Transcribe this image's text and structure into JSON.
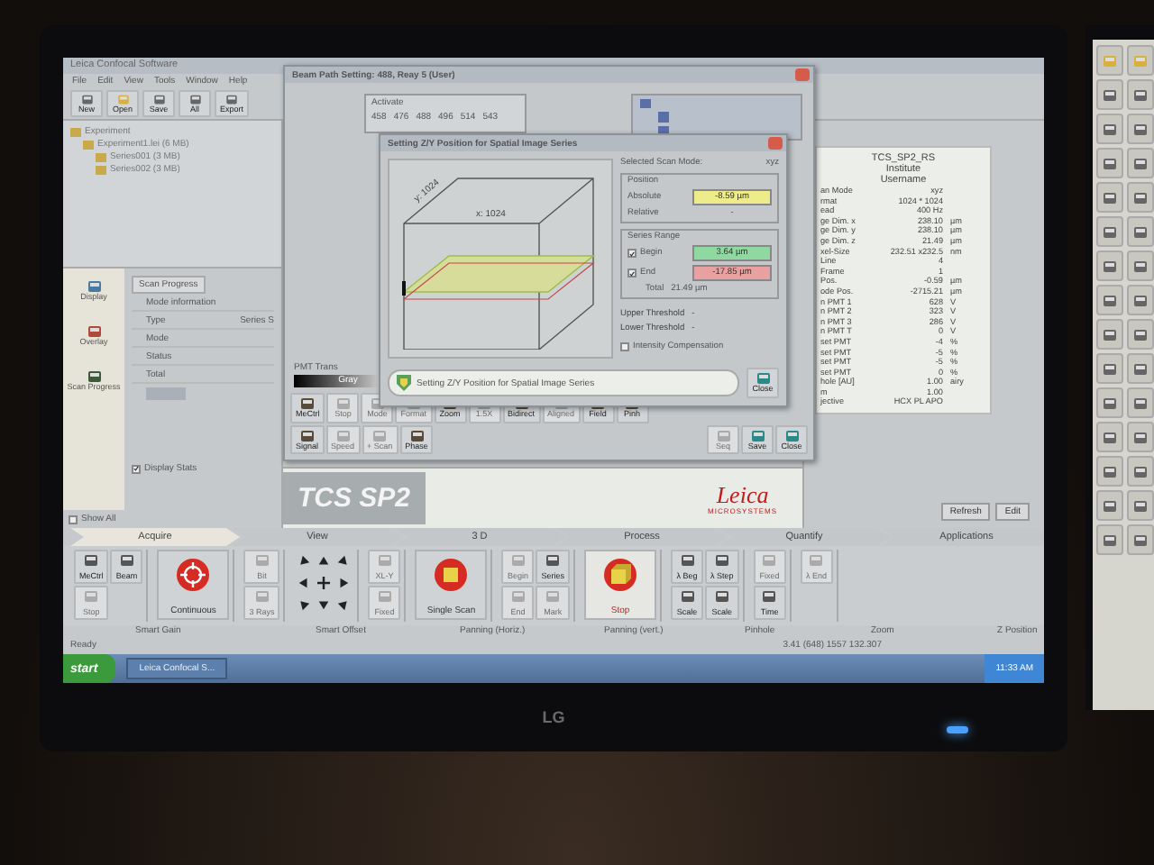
{
  "app": {
    "title": "Leica Confocal Software",
    "menu": [
      "File",
      "Edit",
      "View",
      "Tools",
      "Window",
      "Help"
    ],
    "toolbar": [
      {
        "label": "New"
      },
      {
        "label": "Open"
      },
      {
        "label": "Save"
      },
      {
        "label": "All"
      },
      {
        "label": "Export"
      }
    ],
    "tree": [
      {
        "label": "Experiment",
        "children": [
          {
            "label": "Experiment1.lei (6 MB)",
            "children": [
              {
                "label": "Series001 (3 MB)"
              },
              {
                "label": "Series002 (3 MB)"
              }
            ]
          }
        ]
      }
    ],
    "side_tools": [
      {
        "label": "Display"
      },
      {
        "label": "Overlay"
      },
      {
        "label": "Scan Progress"
      }
    ],
    "scan_progress": {
      "tab": "Scan Progress",
      "rows": [
        {
          "label": "Mode information"
        },
        {
          "label": "Type",
          "value": "Series S"
        },
        {
          "label": "Mode"
        },
        {
          "label": "Status"
        },
        {
          "label": "Total"
        }
      ],
      "display_stats": {
        "label": "Display Stats",
        "checked": true
      }
    },
    "show_all": {
      "label": "Show All",
      "checked": false
    },
    "logo": {
      "product": "TCS SP2",
      "brand": "Leica",
      "tagline": "MICROSYSTEMS"
    },
    "info_panel": {
      "header": [
        "TCS_SP2_RS",
        "Institute",
        "Username"
      ],
      "rows": [
        {
          "label": "an Mode",
          "value": "xyz"
        },
        {
          "label": "rmat",
          "value": "1024 * 1024"
        },
        {
          "label": "ead",
          "value": "400 Hz"
        },
        {
          "label": "ge Dim. x",
          "value": "238.10",
          "unit": "µm"
        },
        {
          "label": "ge Dim. y",
          "value": "238.10",
          "unit": "µm"
        },
        {
          "label": "ge Dim. z",
          "value": "21.49",
          "unit": "µm"
        },
        {
          "label": "xel-Size",
          "value": "232.51 x232.5",
          "unit": "nm"
        },
        {
          "label": "Line",
          "value": "4"
        },
        {
          "label": "Frame",
          "value": "1"
        },
        {
          "label": "Pos.",
          "value": "-0.59",
          "unit": "µm"
        },
        {
          "label": "ode Pos.",
          "value": "-2715.21",
          "unit": "µm"
        },
        {
          "label": "n PMT 1",
          "value": "628",
          "unit": "V"
        },
        {
          "label": "n PMT 2",
          "value": "323",
          "unit": "V"
        },
        {
          "label": "n PMT 3",
          "value": "286",
          "unit": "V"
        },
        {
          "label": "n PMT T",
          "value": "0",
          "unit": "V"
        },
        {
          "label": "set PMT",
          "value": "-4",
          "unit": "%"
        },
        {
          "label": "set PMT",
          "value": "-5",
          "unit": "%"
        },
        {
          "label": "set PMT",
          "value": "-5",
          "unit": "%"
        },
        {
          "label": "set PMT",
          "value": "0",
          "unit": "%"
        },
        {
          "label": "hole [AU]",
          "value": "1.00",
          "unit": "airy"
        },
        {
          "label": "m",
          "value": "1.00"
        },
        {
          "label": "jective",
          "value": "HCX PL APO"
        }
      ],
      "buttons": [
        "Refresh",
        "Edit"
      ]
    },
    "beam_window": {
      "title": "Beam Path Setting: 488, Reay 5 (User)",
      "activate": {
        "title": "Activate",
        "items": [
          "458",
          "476",
          "488",
          "496",
          "514",
          "543"
        ]
      },
      "pmt": {
        "label": "PMT Trans",
        "value": "Gray"
      },
      "tool_rows": [
        [
          {
            "label": "MeCtrl",
            "disabled": false
          },
          {
            "label": "Stop",
            "disabled": true
          },
          {
            "label": "Mode",
            "disabled": true
          },
          {
            "label": "Format",
            "disabled": true
          },
          {
            "label": "Zoom",
            "disabled": false
          },
          {
            "label": "1.5X",
            "disabled": true
          },
          {
            "label": "Bidirect",
            "disabled": false
          },
          {
            "label": "Aligned",
            "disabled": true
          },
          {
            "label": "Field",
            "disabled": false
          },
          {
            "label": "Pinh",
            "disabled": false
          }
        ],
        [
          {
            "label": "Signal",
            "disabled": false
          },
          {
            "label": "Speed",
            "disabled": true
          },
          {
            "label": "+ Scan",
            "disabled": true
          },
          {
            "label": "Phase",
            "disabled": false
          }
        ]
      ],
      "buttons": [
        {
          "label": "Seq",
          "disabled": true
        },
        {
          "label": "Save",
          "disabled": false
        },
        {
          "label": "Close",
          "disabled": false
        }
      ]
    },
    "dialog": {
      "title": "Setting Z/Y Position for Spatial Image Series",
      "x_label": "x: 1024",
      "y_label": "y: 1024",
      "scan_mode": {
        "label": "Selected Scan Mode:",
        "value": "xyz"
      },
      "position": {
        "title": "Position",
        "absolute_label": "Absolute",
        "absolute": "-8.59 µm",
        "relative_label": "Relative",
        "relative": "-"
      },
      "series_range": {
        "title": "Series Range",
        "begin": {
          "label": "Begin",
          "value": "3.64 µm",
          "checked": true
        },
        "end": {
          "label": "End",
          "value": "-17.85 µm",
          "checked": true
        },
        "total_label": "Total",
        "total": "21.49 µm"
      },
      "thresholds": [
        "Upper Threshold   -",
        "Lower Threshold   -"
      ],
      "intensity": {
        "label": "Intensity Compensation",
        "checked": false
      },
      "message": "Setting Z/Y Position for Spatial Image Series",
      "close": "Close"
    },
    "ribbon": {
      "tabs": [
        {
          "label": "Acquire",
          "selected": true
        },
        {
          "label": "View",
          "selected": false
        },
        {
          "label": "3 D",
          "selected": false
        },
        {
          "label": "Process",
          "selected": false
        },
        {
          "label": "Quantify",
          "selected": false
        },
        {
          "label": "Applications",
          "selected": false
        }
      ],
      "groups": [
        [
          {
            "kind": "small",
            "label": "MeCtrl",
            "disabled": false
          },
          {
            "kind": "small",
            "label": "Stop",
            "disabled": true
          },
          {
            "kind": "small",
            "label": "Beam",
            "disabled": false
          }
        ],
        [
          {
            "kind": "big",
            "label": "Continuous"
          }
        ],
        [
          {
            "kind": "small",
            "label": "Bit",
            "disabled": true
          },
          {
            "kind": "small",
            "label": "3 Rays",
            "disabled": true
          }
        ],
        [
          {
            "kind": "pad"
          }
        ],
        [
          {
            "kind": "small",
            "label": "XL-Y",
            "disabled": true
          },
          {
            "kind": "small",
            "label": "Fixed",
            "disabled": true
          }
        ],
        [
          {
            "kind": "big",
            "label": "Single Scan"
          }
        ],
        [
          {
            "kind": "small",
            "label": "Begin",
            "disabled": true
          },
          {
            "kind": "small",
            "label": "End",
            "disabled": true
          },
          {
            "kind": "small",
            "label": "Series",
            "disabled": false
          },
          {
            "kind": "small",
            "label": "Mark",
            "disabled": true
          }
        ],
        [
          {
            "kind": "stop",
            "label": "Stop"
          }
        ],
        [
          {
            "kind": "small",
            "label": "λ Beg",
            "disabled": false
          },
          {
            "kind": "small",
            "label": "Scale",
            "disabled": false
          },
          {
            "kind": "small",
            "label": "λ Step",
            "disabled": false
          },
          {
            "kind": "small",
            "label": "Scale",
            "disabled": false
          }
        ],
        [
          {
            "kind": "small",
            "label": "Fixed",
            "disabled": true
          },
          {
            "kind": "small",
            "label": "Time",
            "disabled": false
          }
        ],
        [
          {
            "kind": "small",
            "label": "λ End",
            "disabled": true
          }
        ]
      ]
    },
    "controls": [
      "Smart Gain",
      "Smart Offset",
      "Panning (Horiz.)",
      "Panning (vert.)",
      "Pinhole",
      "Zoom",
      "Z Position"
    ],
    "status": {
      "text": "Ready",
      "readout": "3.41 (648) 1557 132.307"
    },
    "taskbar": {
      "start": "start",
      "window": "Leica Confocal S...",
      "clock": "11:33 AM"
    }
  },
  "monitor": {
    "brand": "LG"
  }
}
